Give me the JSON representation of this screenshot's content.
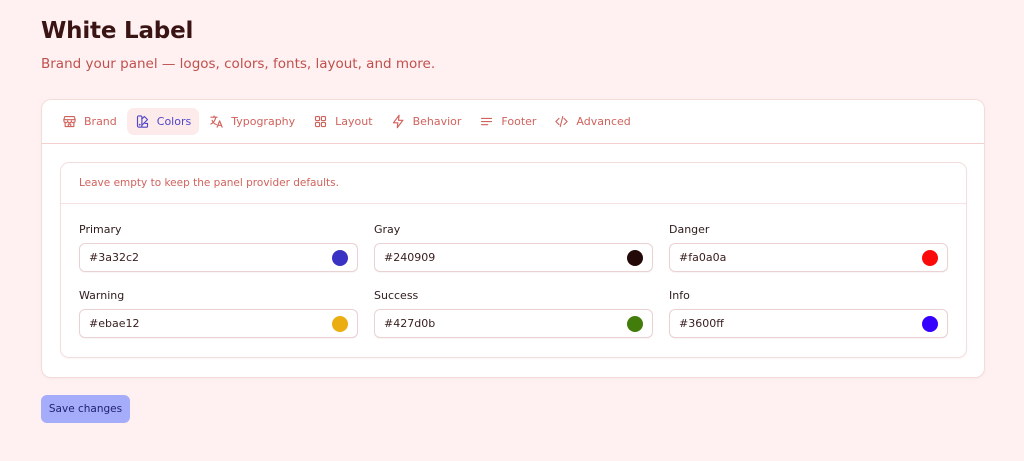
{
  "header": {
    "title": "White Label",
    "subtitle": "Brand your panel — logos, colors, fonts, layout, and more."
  },
  "tabs": [
    {
      "label": "Brand",
      "icon": "storefront-icon",
      "active": false
    },
    {
      "label": "Colors",
      "icon": "swatch-book-icon",
      "active": true
    },
    {
      "label": "Typography",
      "icon": "languages-icon",
      "active": false
    },
    {
      "label": "Layout",
      "icon": "grid-icon",
      "active": false
    },
    {
      "label": "Behavior",
      "icon": "bolt-icon",
      "active": false
    },
    {
      "label": "Footer",
      "icon": "text-lines-icon",
      "active": false
    },
    {
      "label": "Advanced",
      "icon": "code-icon",
      "active": false
    }
  ],
  "colors_panel": {
    "hint": "Leave empty to keep the panel provider defaults.",
    "fields": [
      {
        "label": "Primary",
        "value": "#3a32c2",
        "swatch": "#3a32c2"
      },
      {
        "label": "Gray",
        "value": "#240909",
        "swatch": "#240909"
      },
      {
        "label": "Danger",
        "value": "#fa0a0a",
        "swatch": "#fa0a0a"
      },
      {
        "label": "Warning",
        "value": "#ebae12",
        "swatch": "#ebae12"
      },
      {
        "label": "Success",
        "value": "#427d0b",
        "swatch": "#427d0b"
      },
      {
        "label": "Info",
        "value": "#3600ff",
        "swatch": "#3600ff"
      }
    ]
  },
  "actions": {
    "save_label": "Save changes"
  },
  "theme": {
    "accent": "#4f46c8",
    "tab_text": "#d0625c",
    "background": "#fff1f1",
    "button_bg": "#a5acfa"
  }
}
